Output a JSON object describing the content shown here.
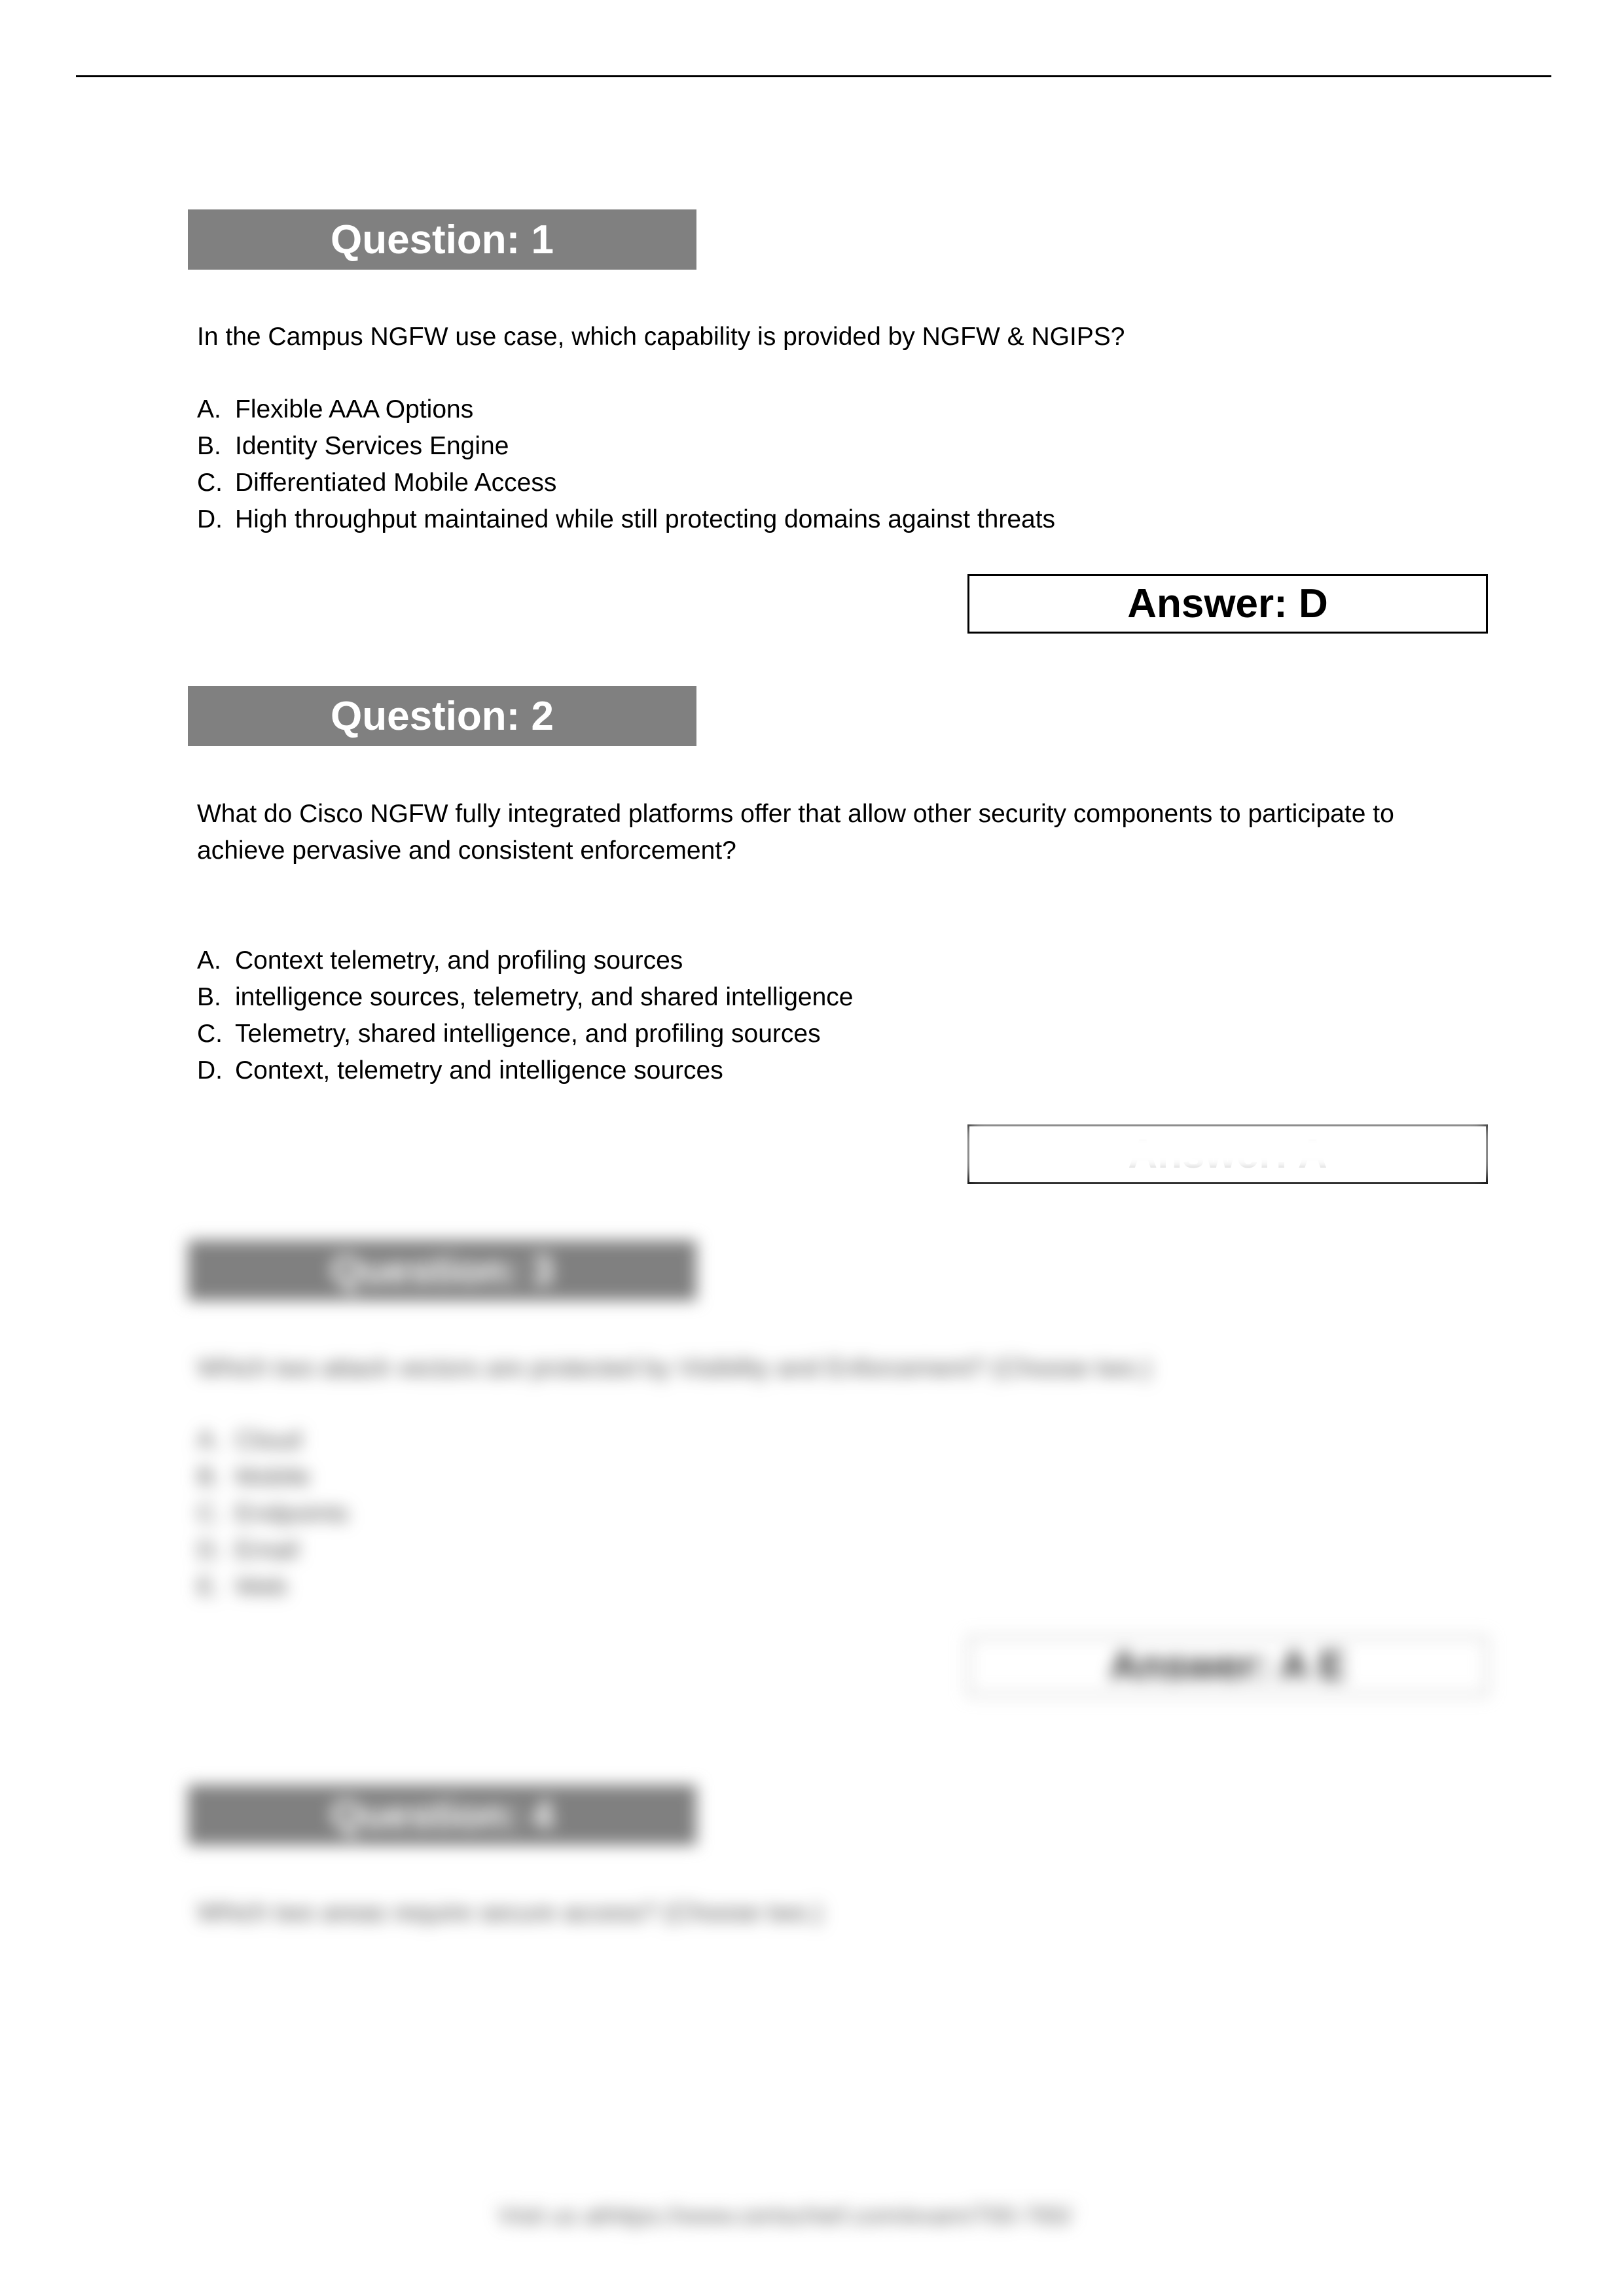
{
  "questions": [
    {
      "header": "Question: 1",
      "text": "In the Campus NGFW use case, which capability is provided by NGFW & NGIPS?",
      "options": [
        {
          "letter": "A.",
          "text": "Flexible AAA Options"
        },
        {
          "letter": "B.",
          "text": "Identity Services Engine"
        },
        {
          "letter": "C.",
          "text": "Differentiated Mobile Access"
        },
        {
          "letter": "D.",
          "text": "High throughput maintained while still protecting domains against threats"
        }
      ],
      "answer": "Answer: D"
    },
    {
      "header": "Question: 2",
      "text_lines": [
        "What do Cisco NGFW fully integrated platforms offer that allow other security components to participate to",
        "achieve pervasive and consistent enforcement?"
      ],
      "options": [
        {
          "letter": "A.",
          "text": "Context telemetry, and profiling sources"
        },
        {
          "letter": "B.",
          "text": "intelligence sources, telemetry, and shared intelligence"
        },
        {
          "letter": "C.",
          "text": "Telemetry, shared intelligence, and profiling sources"
        },
        {
          "letter": "D.",
          "text": "Context, telemetry and intelligence sources"
        }
      ],
      "answer": "Answer: A"
    }
  ],
  "blurred": {
    "q3_header": "Question: 3",
    "q3_text": "Which two attack vectors are protected by Visibility and Enforcement? (Choose two.)",
    "q3_options": [
      {
        "letter": "A.",
        "text": "Cloud"
      },
      {
        "letter": "B.",
        "text": "Mobile"
      },
      {
        "letter": "C.",
        "text": "Endpoints"
      },
      {
        "letter": "D.",
        "text": "Email"
      },
      {
        "letter": "E.",
        "text": "Web"
      }
    ],
    "q3_answer": "Answer: A E",
    "q4_header": "Question: 4",
    "q4_text": "Which two areas require secure access? (Choose two.)",
    "footer": "Visit us athttps://www.certschief.com/exam/700-765/"
  }
}
